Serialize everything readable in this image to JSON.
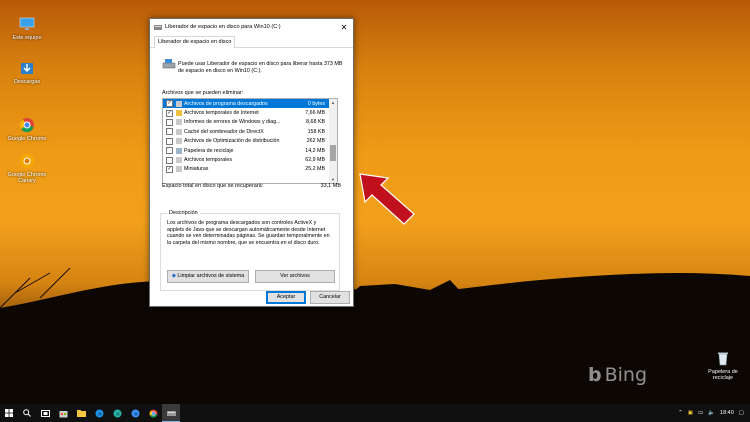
{
  "desktop": {
    "icons": [
      {
        "label": "Este equipo",
        "kind": "computer"
      },
      {
        "label": "Descargas",
        "kind": "download"
      },
      {
        "label": "Google Chrome",
        "kind": "chrome"
      },
      {
        "label": "Google Chrome Canary",
        "kind": "chrome-canary"
      },
      {
        "label": "Papelera de reciclaje",
        "kind": "recycle-bin"
      }
    ],
    "watermark": "Bing"
  },
  "dialog": {
    "title": "Liberador de espacio en disco para Win10 (C:)",
    "tab": "Liberador de espacio en disco",
    "info": "Puede usar Liberador de espacio en disco para liberar hasta 373 MB de espacio en disco en Win10 (C:).",
    "files_label": "Archivos que se pueden eliminar:",
    "files": [
      {
        "name": "Archivos de programa descargados",
        "size": "0 bytes",
        "checked": true,
        "selected": true
      },
      {
        "name": "Archivos temporales de Internet",
        "size": "7,66 MB",
        "checked": true,
        "selected": false
      },
      {
        "name": "Informes de errores de Windows y diag...",
        "size": "8,68 KB",
        "checked": false,
        "selected": false
      },
      {
        "name": "Caché del sombreador de DirectX",
        "size": "158 KB",
        "checked": false,
        "selected": false
      },
      {
        "name": "Archivos de Optimización de distribución",
        "size": "262 MB",
        "checked": false,
        "selected": false
      },
      {
        "name": "Papelera de reciclaje",
        "size": "14,2 MB",
        "checked": false,
        "selected": false
      },
      {
        "name": "Archivos temporales",
        "size": "62,9 MB",
        "checked": false,
        "selected": false
      },
      {
        "name": "Miniaturas",
        "size": "25,2 MB",
        "checked": true,
        "selected": false
      }
    ],
    "total_label": "Espacio total en disco que se recuperará:",
    "total_value": "33,1 MB",
    "description_label": "Descripción",
    "description": "Los archivos de programa descargados son controles ActiveX y applets de Java que se descargan automáticamente desde Internet cuando se ven determinadas páginas. Se guardan temporalmente en la carpeta del mismo nombre, que se encuentra en el disco duro.",
    "cleanup_button": "Limpiar archivos de sistema",
    "view_files_button": "Ver archivos",
    "ok_button": "Aceptar",
    "cancel_button": "Cancelar"
  },
  "taskbar": {
    "time": "18:40",
    "apps": [
      "search",
      "task-view",
      "store",
      "file-explorer",
      "edge",
      "edge-beta",
      "edge-dev",
      "chrome",
      "disk-cleanup"
    ]
  },
  "colors": {
    "accent": "#0078d7",
    "arrow": "#c0101e"
  }
}
